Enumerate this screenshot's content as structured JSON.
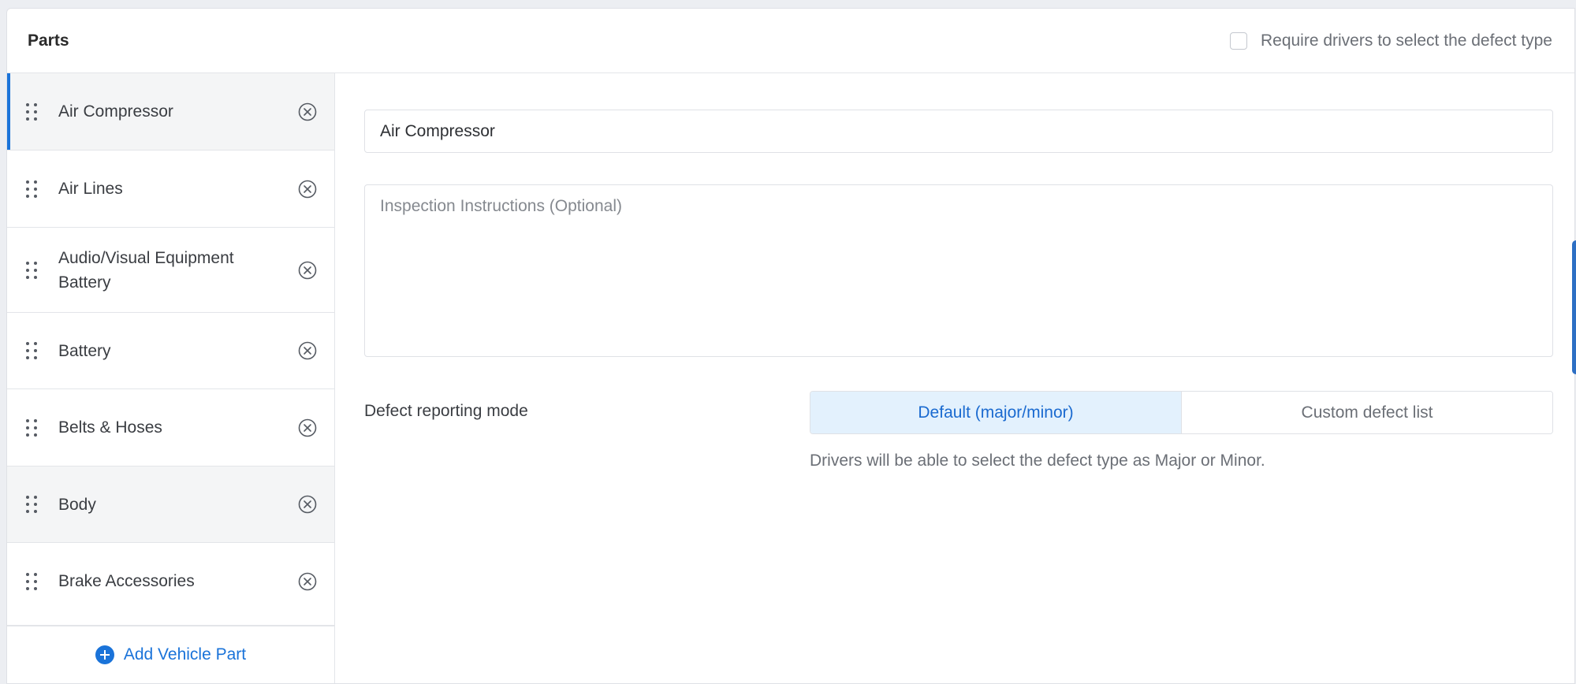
{
  "header": {
    "title": "Parts",
    "require_label": "Require drivers to select the defect type",
    "require_checked": false
  },
  "sidebar": {
    "items": [
      {
        "label": "Air Compressor",
        "active": true
      },
      {
        "label": "Air Lines"
      },
      {
        "label": "Audio/Visual Equipment Battery"
      },
      {
        "label": "Battery"
      },
      {
        "label": "Belts & Hoses"
      },
      {
        "label": "Body",
        "hover": true
      },
      {
        "label": "Brake Accessories"
      }
    ],
    "add_label": "Add Vehicle Part"
  },
  "main": {
    "name_value": "Air Compressor",
    "instructions_placeholder": "Inspection Instructions (Optional)",
    "mode_label": "Defect reporting mode",
    "mode_options": [
      "Default (major/minor)",
      "Custom defect list"
    ],
    "mode_selected": "Default (major/minor)",
    "help_text": "Drivers will be able to select the defect type as Major or Minor."
  },
  "colors": {
    "accent": "#1a73d9",
    "selected_bg": "#e3f1fd"
  }
}
